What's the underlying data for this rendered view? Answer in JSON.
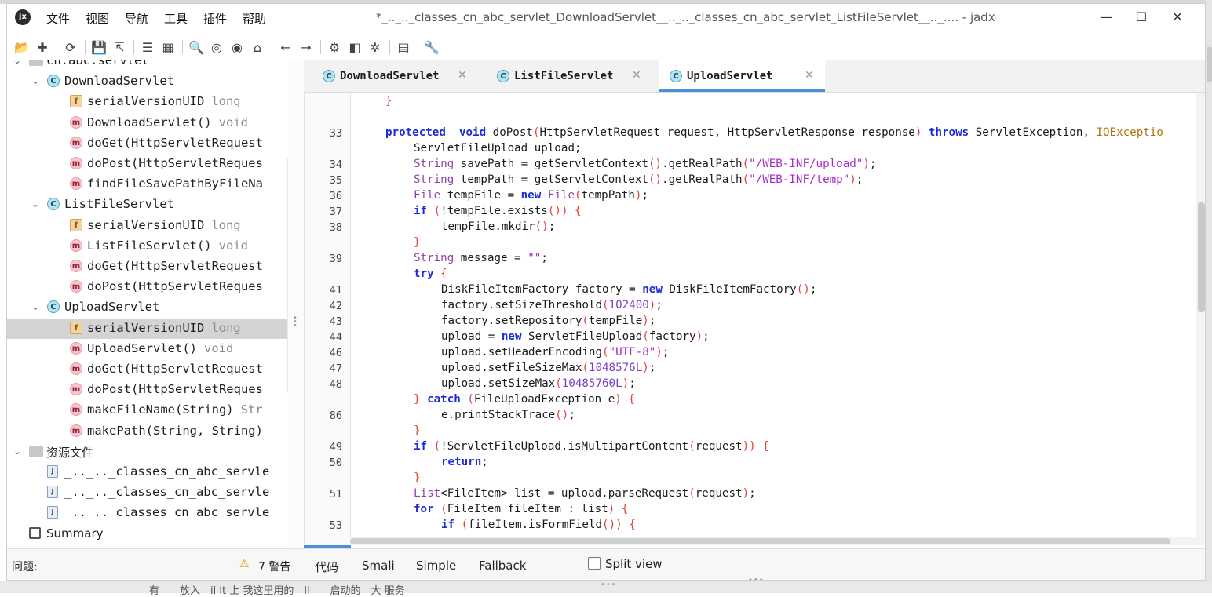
{
  "background_text": "有　　放入　il  lt 上 我这里用的　ll　　启动的　大 服务",
  "app": {
    "logo_text": "jx",
    "window_title": "*_.._.._classes_cn_abc_servlet_DownloadServlet__.._.._classes_cn_abc_servlet_ListFileServlet__.._.... - jadx-gui"
  },
  "menu": [
    "文件",
    "视图",
    "导航",
    "工具",
    "插件",
    "帮助"
  ],
  "window_controls": {
    "minimize": "—",
    "maximize": "☐",
    "close": "✕"
  },
  "toolbar": [
    {
      "name": "open-file-icon",
      "glyph": "📂"
    },
    {
      "name": "add-files-icon",
      "glyph": "✚"
    },
    {
      "name": "sep"
    },
    {
      "name": "sync-icon",
      "glyph": "⟳"
    },
    {
      "name": "sep"
    },
    {
      "name": "save-all-icon",
      "glyph": "💾"
    },
    {
      "name": "export-icon",
      "glyph": "⇱"
    },
    {
      "name": "sep"
    },
    {
      "name": "flatten-packages-icon",
      "glyph": "☰"
    },
    {
      "name": "show-package-icon",
      "glyph": "▦"
    },
    {
      "name": "sep"
    },
    {
      "name": "search-icon",
      "glyph": "🔍"
    },
    {
      "name": "find-class-icon",
      "glyph": "◎"
    },
    {
      "name": "find-usage-icon",
      "glyph": "◉"
    },
    {
      "name": "home-icon",
      "glyph": "⌂"
    },
    {
      "name": "sep"
    },
    {
      "name": "back-icon",
      "glyph": "←"
    },
    {
      "name": "forward-icon",
      "glyph": "→"
    },
    {
      "name": "sep"
    },
    {
      "name": "deobfuscation-icon",
      "glyph": "⚙"
    },
    {
      "name": "quark-icon",
      "glyph": "◧"
    },
    {
      "name": "debug-icon",
      "glyph": "✲"
    },
    {
      "name": "sep"
    },
    {
      "name": "log-viewer-icon",
      "glyph": "▤"
    },
    {
      "name": "sep"
    },
    {
      "name": "preferences-icon",
      "glyph": "🔧"
    }
  ],
  "tree": [
    {
      "indent": 0,
      "icon": "folder",
      "label": "cn.abc.servlet",
      "type": "",
      "chevron": "⌄"
    },
    {
      "indent": 1,
      "icon": "class",
      "label": "DownloadServlet",
      "type": "",
      "chevron": "⌄"
    },
    {
      "indent": 2,
      "icon": "field",
      "label": "serialVersionUID",
      "type": "long"
    },
    {
      "indent": 2,
      "icon": "method",
      "label": "DownloadServlet()",
      "type": "void"
    },
    {
      "indent": 2,
      "icon": "method",
      "label": "doGet(HttpServletRequest",
      "type": ""
    },
    {
      "indent": 2,
      "icon": "method",
      "label": "doPost(HttpServletReques",
      "type": ""
    },
    {
      "indent": 2,
      "icon": "method",
      "label": "findFileSavePathByFileNa",
      "type": ""
    },
    {
      "indent": 1,
      "icon": "class",
      "label": "ListFileServlet",
      "type": "",
      "chevron": "⌄"
    },
    {
      "indent": 2,
      "icon": "field",
      "label": "serialVersionUID",
      "type": "long"
    },
    {
      "indent": 2,
      "icon": "method",
      "label": "ListFileServlet()",
      "type": "void"
    },
    {
      "indent": 2,
      "icon": "method",
      "label": "doGet(HttpServletRequest",
      "type": ""
    },
    {
      "indent": 2,
      "icon": "method",
      "label": "doPost(HttpServletReques",
      "type": ""
    },
    {
      "indent": 1,
      "icon": "class",
      "label": "UploadServlet",
      "type": "",
      "chevron": "⌄"
    },
    {
      "indent": 2,
      "icon": "field",
      "label": "serialVersionUID",
      "type": "long",
      "selected": true
    },
    {
      "indent": 2,
      "icon": "method",
      "label": "UploadServlet()",
      "type": "void"
    },
    {
      "indent": 2,
      "icon": "method",
      "label": "doGet(HttpServletRequest",
      "type": ""
    },
    {
      "indent": 2,
      "icon": "method",
      "label": "doPost(HttpServletReques",
      "type": ""
    },
    {
      "indent": 2,
      "icon": "method",
      "label": "makeFileName(String)",
      "type": "Str"
    },
    {
      "indent": 2,
      "icon": "method",
      "label": "makePath(String, String)",
      "type": ""
    },
    {
      "indent": 0,
      "icon": "folder",
      "label": "资源文件",
      "type": "",
      "chevron": "⌄",
      "sans": true
    },
    {
      "indent": 1,
      "icon": "file",
      "label": "_.._.._classes_cn_abc_servle",
      "type": ""
    },
    {
      "indent": 1,
      "icon": "file",
      "label": "_.._.._classes_cn_abc_servle",
      "type": ""
    },
    {
      "indent": 1,
      "icon": "file",
      "label": "_.._.._classes_cn_abc_servle",
      "type": ""
    },
    {
      "indent": 0,
      "icon": "summary",
      "label": "Summary",
      "type": "",
      "sans": true
    }
  ],
  "tabs": [
    {
      "label": "DownloadServlet",
      "active": false
    },
    {
      "label": "ListFileServlet",
      "active": false
    },
    {
      "label": "UploadServlet",
      "active": true
    }
  ],
  "code": [
    {
      "ln": "",
      "indent": 1,
      "tokens": [
        [
          "b",
          "}"
        ]
      ]
    },
    {
      "ln": "",
      "indent": 0,
      "tokens": []
    },
    {
      "ln": "33",
      "indent": 1,
      "tokens": [
        [
          "k",
          "protected"
        ],
        [
          "",
          "  "
        ],
        [
          "k",
          "void"
        ],
        [
          "",
          " doPost"
        ],
        [
          "b",
          "("
        ],
        [
          "",
          "HttpServletRequest request, HttpServletResponse response"
        ],
        [
          "b",
          ")"
        ],
        [
          "",
          " "
        ],
        [
          "k",
          "throws"
        ],
        [
          "",
          " ServletException, "
        ],
        [
          "ty",
          "IOExceptio"
        ]
      ]
    },
    {
      "ln": "",
      "indent": 2,
      "tokens": [
        [
          "",
          "ServletFileUpload upload;"
        ]
      ]
    },
    {
      "ln": "34",
      "indent": 2,
      "tokens": [
        [
          "t",
          "String"
        ],
        [
          "",
          " savePath = getServletContext"
        ],
        [
          "b",
          "()"
        ],
        [
          "",
          ".getRealPath"
        ],
        [
          "b",
          "("
        ],
        [
          "s",
          "\"/WEB-INF/upload\""
        ],
        [
          "b",
          ")"
        ],
        [
          "",
          ";"
        ]
      ]
    },
    {
      "ln": "35",
      "indent": 2,
      "tokens": [
        [
          "t",
          "String"
        ],
        [
          "",
          " tempPath = getServletContext"
        ],
        [
          "b",
          "()"
        ],
        [
          "",
          ".getRealPath"
        ],
        [
          "b",
          "("
        ],
        [
          "s",
          "\"/WEB-INF/temp\""
        ],
        [
          "b",
          ")"
        ],
        [
          "",
          ";"
        ]
      ]
    },
    {
      "ln": "36",
      "indent": 2,
      "tokens": [
        [
          "t",
          "File"
        ],
        [
          "",
          " tempFile = "
        ],
        [
          "k",
          "new"
        ],
        [
          "",
          " "
        ],
        [
          "t",
          "File"
        ],
        [
          "b",
          "("
        ],
        [
          "",
          "tempPath"
        ],
        [
          "b",
          ")"
        ],
        [
          "",
          ";"
        ]
      ]
    },
    {
      "ln": "37",
      "indent": 2,
      "tokens": [
        [
          "k",
          "if"
        ],
        [
          "",
          " "
        ],
        [
          "b",
          "("
        ],
        [
          "",
          "!tempFile.exists"
        ],
        [
          "b",
          "())"
        ],
        [
          "",
          " "
        ],
        [
          "b",
          "{"
        ]
      ]
    },
    {
      "ln": "38",
      "indent": 3,
      "tokens": [
        [
          "",
          "tempFile.mkdir"
        ],
        [
          "b",
          "()"
        ],
        [
          "",
          ";"
        ]
      ]
    },
    {
      "ln": "",
      "indent": 2,
      "tokens": [
        [
          "b",
          "}"
        ]
      ]
    },
    {
      "ln": "39",
      "indent": 2,
      "tokens": [
        [
          "t",
          "String"
        ],
        [
          "",
          " message = "
        ],
        [
          "s",
          "\"\""
        ],
        [
          "",
          ";"
        ]
      ]
    },
    {
      "ln": "",
      "indent": 2,
      "tokens": [
        [
          "k",
          "try"
        ],
        [
          "",
          " "
        ],
        [
          "b",
          "{"
        ]
      ]
    },
    {
      "ln": "41",
      "indent": 3,
      "tokens": [
        [
          "",
          "DiskFileItemFactory factory = "
        ],
        [
          "k",
          "new"
        ],
        [
          "",
          " DiskFileItemFactory"
        ],
        [
          "b",
          "()"
        ],
        [
          "",
          ";"
        ]
      ]
    },
    {
      "ln": "42",
      "indent": 3,
      "tokens": [
        [
          "",
          "factory.setSizeThreshold"
        ],
        [
          "b",
          "("
        ],
        [
          "n",
          "102400"
        ],
        [
          "b",
          ")"
        ],
        [
          "",
          ";"
        ]
      ]
    },
    {
      "ln": "43",
      "indent": 3,
      "tokens": [
        [
          "",
          "factory.setRepository"
        ],
        [
          "b",
          "("
        ],
        [
          "",
          "tempFile"
        ],
        [
          "b",
          ")"
        ],
        [
          "",
          ";"
        ]
      ]
    },
    {
      "ln": "44",
      "indent": 3,
      "tokens": [
        [
          "",
          "upload = "
        ],
        [
          "k",
          "new"
        ],
        [
          "",
          " ServletFileUpload"
        ],
        [
          "b",
          "("
        ],
        [
          "",
          "factory"
        ],
        [
          "b",
          ")"
        ],
        [
          "",
          ";"
        ]
      ]
    },
    {
      "ln": "46",
      "indent": 3,
      "tokens": [
        [
          "",
          "upload.setHeaderEncoding"
        ],
        [
          "b",
          "("
        ],
        [
          "s",
          "\"UTF-8\""
        ],
        [
          "b",
          ")"
        ],
        [
          "",
          ";"
        ]
      ]
    },
    {
      "ln": "47",
      "indent": 3,
      "tokens": [
        [
          "",
          "upload.setFileSizeMax"
        ],
        [
          "b",
          "("
        ],
        [
          "n",
          "1048576L"
        ],
        [
          "b",
          ")"
        ],
        [
          "",
          ";"
        ]
      ]
    },
    {
      "ln": "48",
      "indent": 3,
      "tokens": [
        [
          "",
          "upload.setSizeMax"
        ],
        [
          "b",
          "("
        ],
        [
          "n",
          "10485760L"
        ],
        [
          "b",
          ")"
        ],
        [
          "",
          ";"
        ]
      ]
    },
    {
      "ln": "",
      "indent": 2,
      "tokens": [
        [
          "b",
          "}"
        ],
        [
          "",
          " "
        ],
        [
          "k",
          "catch"
        ],
        [
          "",
          " "
        ],
        [
          "b",
          "("
        ],
        [
          "",
          "FileUploadException e"
        ],
        [
          "b",
          ")"
        ],
        [
          "",
          " "
        ],
        [
          "b",
          "{"
        ]
      ]
    },
    {
      "ln": "86",
      "indent": 3,
      "tokens": [
        [
          "",
          "e.printStackTrace"
        ],
        [
          "b",
          "()"
        ],
        [
          "",
          ";"
        ]
      ]
    },
    {
      "ln": "",
      "indent": 2,
      "tokens": [
        [
          "b",
          "}"
        ]
      ]
    },
    {
      "ln": "49",
      "indent": 2,
      "tokens": [
        [
          "k",
          "if"
        ],
        [
          "",
          " "
        ],
        [
          "b",
          "("
        ],
        [
          "",
          "!ServletFileUpload.isMultipartContent"
        ],
        [
          "b",
          "("
        ],
        [
          "",
          "request"
        ],
        [
          "b",
          "))"
        ],
        [
          "",
          " "
        ],
        [
          "b",
          "{"
        ]
      ]
    },
    {
      "ln": "50",
      "indent": 3,
      "tokens": [
        [
          "k",
          "return"
        ],
        [
          "",
          ";"
        ]
      ]
    },
    {
      "ln": "",
      "indent": 2,
      "tokens": [
        [
          "b",
          "}"
        ]
      ]
    },
    {
      "ln": "51",
      "indent": 2,
      "tokens": [
        [
          "t",
          "List"
        ],
        [
          "",
          "<FileItem> list = upload.parseRequest"
        ],
        [
          "b",
          "("
        ],
        [
          "",
          "request"
        ],
        [
          "b",
          ")"
        ],
        [
          "",
          ";"
        ]
      ]
    },
    {
      "ln": "",
      "indent": 2,
      "tokens": [
        [
          "k",
          "for"
        ],
        [
          "",
          " "
        ],
        [
          "b",
          "("
        ],
        [
          "",
          "FileItem fileItem : list"
        ],
        [
          "b",
          ")"
        ],
        [
          "",
          " "
        ],
        [
          "b",
          "{"
        ]
      ]
    },
    {
      "ln": "53",
      "indent": 3,
      "tokens": [
        [
          "k",
          "if"
        ],
        [
          "",
          " "
        ],
        [
          "b",
          "("
        ],
        [
          "",
          "fileItem.isFormField"
        ],
        [
          "b",
          "())"
        ],
        [
          "",
          " "
        ],
        [
          "b",
          "{"
        ]
      ]
    }
  ],
  "status": {
    "problems_label": "问题:",
    "warnings_label": "7 警告",
    "view_tabs": [
      "代码",
      "Smali",
      "Simple",
      "Fallback"
    ],
    "split_view_label": "Split view"
  }
}
